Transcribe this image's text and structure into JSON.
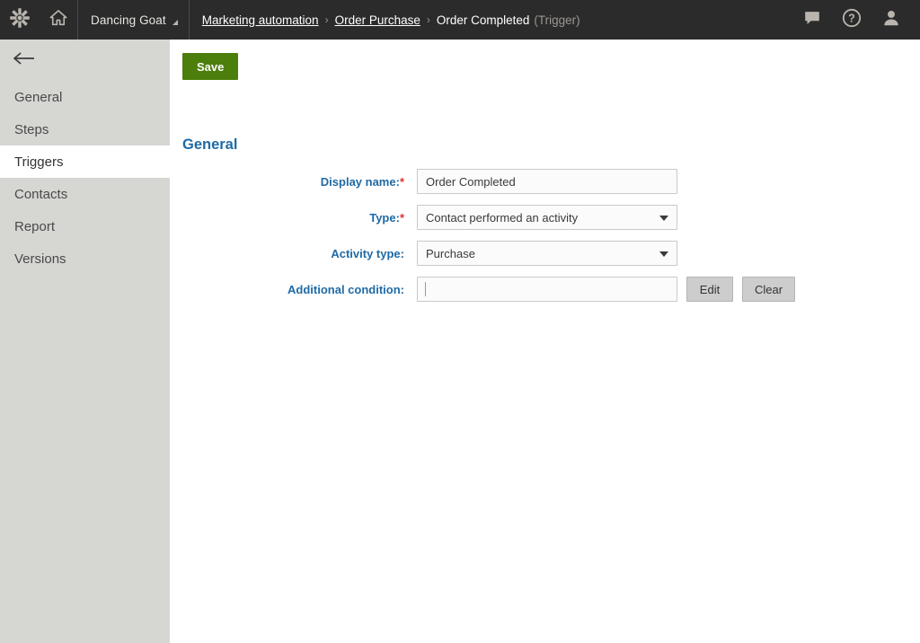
{
  "topbar": {
    "logo_icon": "kentico-asterisk-logo",
    "home_icon": "home-icon",
    "site_name": "Dancing Goat",
    "site_dropdown_icon": "corner-dropdown-triangle-icon",
    "breadcrumb": {
      "items": [
        {
          "label": "Marketing automation",
          "link": true
        },
        {
          "label": "Order Purchase",
          "link": true
        },
        {
          "label": "Order Completed",
          "link": false
        }
      ],
      "separator": "›",
      "suffix": "(Trigger)"
    },
    "right_icons": [
      {
        "name": "chat-icon",
        "label": "Messages"
      },
      {
        "name": "help-icon",
        "label": "Help"
      },
      {
        "name": "user-icon",
        "label": "User"
      }
    ]
  },
  "sidebar": {
    "back_icon": "back-arrow-icon",
    "items": [
      {
        "label": "General",
        "active": false
      },
      {
        "label": "Steps",
        "active": false
      },
      {
        "label": "Triggers",
        "active": true
      },
      {
        "label": "Contacts",
        "active": false
      },
      {
        "label": "Report",
        "active": false
      },
      {
        "label": "Versions",
        "active": false
      }
    ]
  },
  "main": {
    "save_label": "Save",
    "section_title": "General",
    "fields": {
      "display_name": {
        "label": "Display name:",
        "required": true,
        "value": "Order Completed",
        "placeholder": ""
      },
      "type": {
        "label": "Type:",
        "required": true,
        "value": "Contact performed an activity",
        "dropdown_icon": "chevron-down-icon"
      },
      "activity_type": {
        "label": "Activity type:",
        "required": false,
        "value": "Purchase",
        "dropdown_icon": "chevron-down-icon"
      },
      "additional_condition": {
        "label": "Additional condition:",
        "required": false,
        "value": "",
        "placeholder": "",
        "edit_label": "Edit",
        "clear_label": "Clear"
      }
    }
  },
  "colors": {
    "topbar_bg": "#2b2b2b",
    "sidebar_bg": "#d6d7d3",
    "save_green": "#4b7e0b",
    "label_blue": "#1f6aa5",
    "required_red": "#e03030",
    "button_gray": "#cdcdcd"
  }
}
